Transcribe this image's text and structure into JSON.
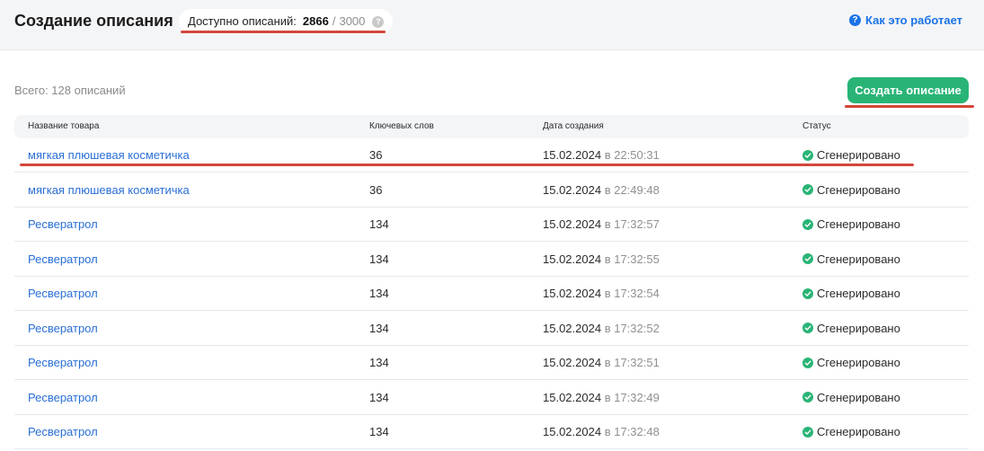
{
  "header": {
    "title": "Создание описания",
    "quota": {
      "label": "Доступно описаний:",
      "used": "2866",
      "separator": "/",
      "total": "3000",
      "help_icon": "?"
    },
    "help_link": {
      "icon": "?",
      "label": "Как это работает"
    }
  },
  "toolbar": {
    "total_label": "Всего: 128 описаний",
    "create_button": "Создать описание"
  },
  "table": {
    "columns": [
      "Название товара",
      "Ключевых слов",
      "Дата создания",
      "Статус"
    ],
    "rows": [
      {
        "name": "мягкая плюшевая косметичка",
        "keywords": "36",
        "date": "15.02.2024",
        "time": "в 22:50:31",
        "status": "Сгенерировано"
      },
      {
        "name": "мягкая плюшевая косметичка",
        "keywords": "36",
        "date": "15.02.2024",
        "time": "в 22:49:48",
        "status": "Сгенерировано"
      },
      {
        "name": "Ресвератрол",
        "keywords": "134",
        "date": "15.02.2024",
        "time": "в 17:32:57",
        "status": "Сгенерировано"
      },
      {
        "name": "Ресвератрол",
        "keywords": "134",
        "date": "15.02.2024",
        "time": "в 17:32:55",
        "status": "Сгенерировано"
      },
      {
        "name": "Ресвератрол",
        "keywords": "134",
        "date": "15.02.2024",
        "time": "в 17:32:54",
        "status": "Сгенерировано"
      },
      {
        "name": "Ресвератрол",
        "keywords": "134",
        "date": "15.02.2024",
        "time": "в 17:32:52",
        "status": "Сгенерировано"
      },
      {
        "name": "Ресвератрол",
        "keywords": "134",
        "date": "15.02.2024",
        "time": "в 17:32:51",
        "status": "Сгенерировано"
      },
      {
        "name": "Ресвератрол",
        "keywords": "134",
        "date": "15.02.2024",
        "time": "в 17:32:49",
        "status": "Сгенерировано"
      },
      {
        "name": "Ресвератрол",
        "keywords": "134",
        "date": "15.02.2024",
        "time": "в 17:32:48",
        "status": "Сгенерировано"
      }
    ]
  },
  "colors": {
    "accent_green": "#29b476",
    "link_blue": "#2a6fd6",
    "annotation_red": "#d4463a"
  }
}
